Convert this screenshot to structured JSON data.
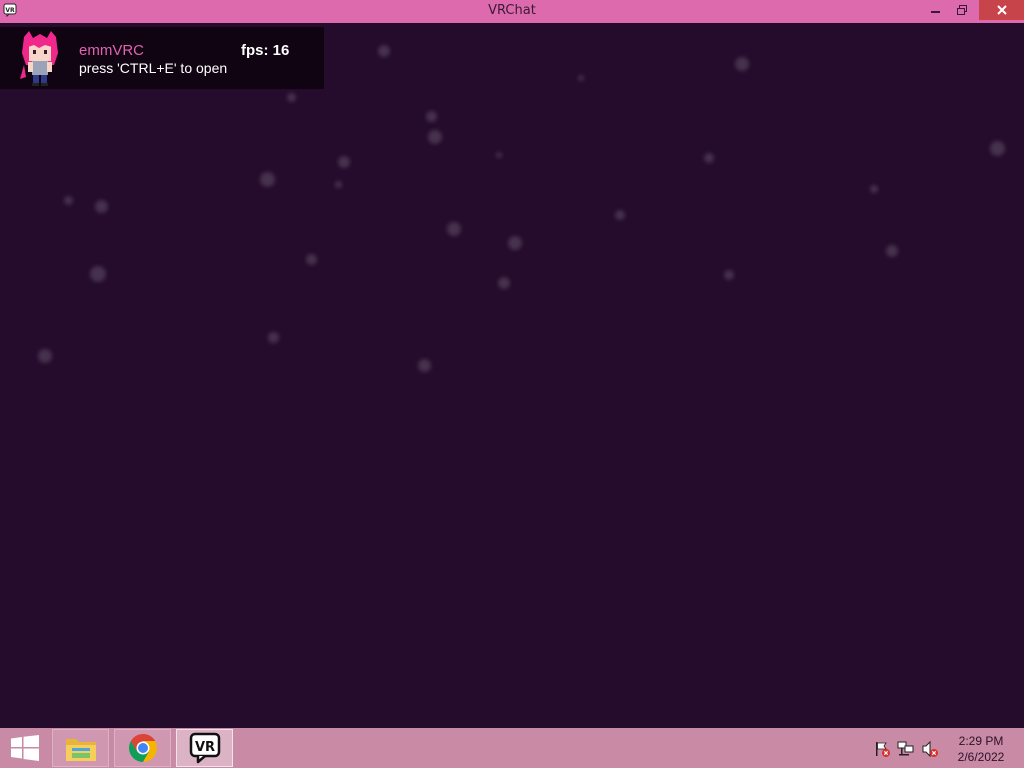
{
  "window": {
    "title": "VRChat",
    "app_icon": "vr-logo-icon",
    "accent_color": "#dc6aac",
    "background_color": "#250b2c"
  },
  "notification": {
    "username": "emmVRC",
    "fps_text": "fps: 16",
    "hint": "press 'CTRL+E' to open",
    "avatar": "pink-haired-character-icon"
  },
  "taskbar": {
    "start_icon": "windows-logo-icon",
    "apps": [
      {
        "name": "File Explorer",
        "icon": "folder-icon"
      },
      {
        "name": "Google Chrome",
        "icon": "chrome-icon"
      },
      {
        "name": "VRChat",
        "icon": "vr-logo-icon"
      }
    ],
    "tray": [
      "action-center-flag-icon",
      "network-icon",
      "volume-muted-icon"
    ],
    "clock": {
      "time": "2:29 PM",
      "date": "2/6/2022"
    }
  }
}
